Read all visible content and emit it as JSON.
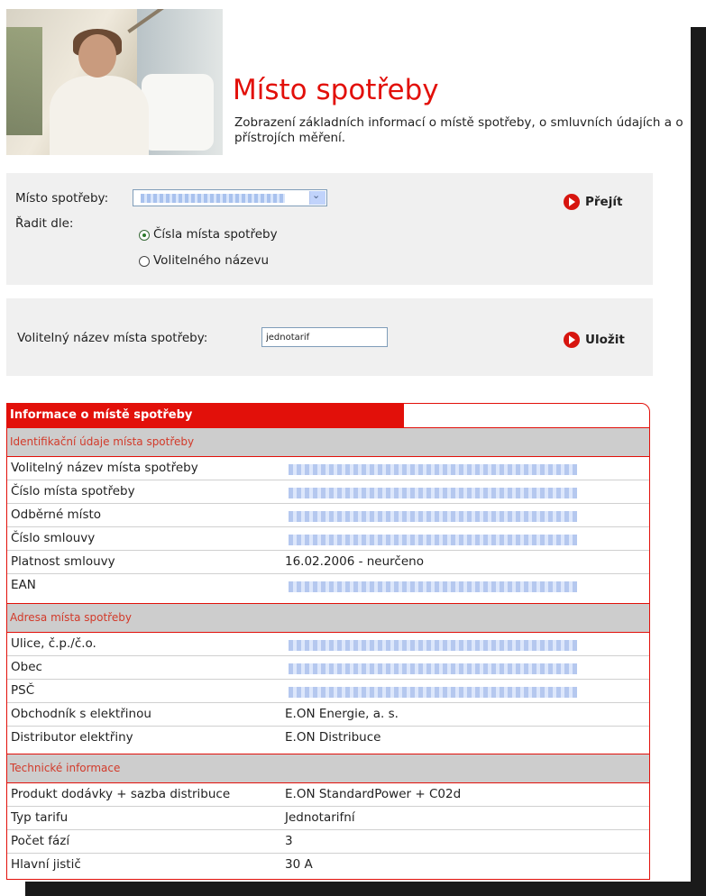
{
  "header": {
    "title": "Místo spotřeby",
    "subtitle": "Zobrazení základních informací o místě spotřeby, o smluvních údajích a o přístrojích měření."
  },
  "filter": {
    "place_label": "Místo spotřeby:",
    "sort_label": "Řadit dle:",
    "sort_options": [
      {
        "label": "Čísla místa spotřeby",
        "selected": true
      },
      {
        "label": "Volitelného názevu",
        "selected": false
      }
    ],
    "go_label": "Přejít"
  },
  "rename": {
    "label": "Volitelný název místa spotřeby:",
    "value": "jednotarif",
    "save_label": "Uložit"
  },
  "info": {
    "heading": "Informace o místě spotřeby",
    "sections": [
      {
        "title": "Identifikační údaje místa spotřeby",
        "rows": [
          {
            "key": "Volitelný název místa spotřeby",
            "value": ""
          },
          {
            "key": "Číslo místa spotřeby",
            "value": ""
          },
          {
            "key": "Odběrné místo",
            "value": ""
          },
          {
            "key": "Číslo smlouvy",
            "value": ""
          },
          {
            "key": "Platnost smlouvy",
            "value": "16.02.2006 - neurčeno"
          },
          {
            "key": "EAN",
            "value": ""
          }
        ]
      },
      {
        "title": "Adresa místa spotřeby",
        "rows": [
          {
            "key": "Ulice, č.p./č.o.",
            "value": ""
          },
          {
            "key": "Obec",
            "value": ""
          },
          {
            "key": "PSČ",
            "value": ""
          },
          {
            "key": "Obchodník s elektřinou",
            "value": "E.ON Energie, a. s."
          },
          {
            "key": "Distributor elektřiny",
            "value": "E.ON Distribuce"
          }
        ]
      },
      {
        "title": "Technické informace",
        "rows": [
          {
            "key": "Produkt dodávky + sazba distribuce",
            "value": "E.ON StandardPower + C02d"
          },
          {
            "key": "Typ tarifu",
            "value": "Jednotarifní"
          },
          {
            "key": "Počet fází",
            "value": "3"
          },
          {
            "key": "Hlavní jistič",
            "value": "30 A"
          }
        ]
      }
    ]
  },
  "colors": {
    "accent": "#e2100a",
    "section_bg": "#cdcdcd",
    "panel_bg": "#f0f0f0"
  }
}
